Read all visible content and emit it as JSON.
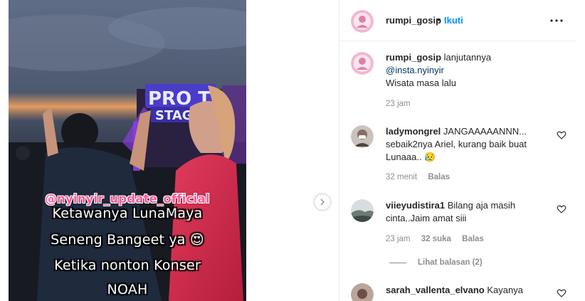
{
  "media": {
    "overlay_handle": "@nyinyir_update_official",
    "overlay_lines": [
      "Ketawanya LunaMaya",
      "Seneng Bangeet ya 😍",
      "Ketika nonton Konser",
      "NOAH"
    ],
    "stage_sign": [
      "PRO T",
      "STAG"
    ]
  },
  "post": {
    "username": "rumpi_gosip",
    "separator": "•",
    "follow_label": "Ikuti",
    "caption": {
      "username": "rumpi_gosip",
      "text_line1": "lanjutannya",
      "mention": "@insta.nyinyir",
      "text_line3": "Wisata masa lalu",
      "time": "23 jam"
    }
  },
  "comments": [
    {
      "username": "ladymongrel",
      "text_line1": "JANGAAAAANNN...",
      "text_line2": "sebaik2nya Ariel, kurang baik buat",
      "text_line3": "Lunaaa.. 😥",
      "time": "32 menit",
      "reply_label": "Balas"
    },
    {
      "username": "viieyudistira1",
      "text_line1": "Bilang aja masih",
      "text_line2": "cinta..Jaim amat siii",
      "time": "23 jam",
      "likes": "32 suka",
      "reply_label": "Balas",
      "view_replies": "Lihat balasan (2)"
    },
    {
      "username": "sarah_vallenta_elvano",
      "text_line1": "Kayanya"
    }
  ],
  "colors": {
    "accent": "#0095f6",
    "text": "#262626",
    "muted": "#8e8e8e",
    "overlay_handle": "#ff5a99"
  },
  "icons": [
    "chevron-right-icon",
    "more-horizontal-icon",
    "heart-outline-icon"
  ]
}
